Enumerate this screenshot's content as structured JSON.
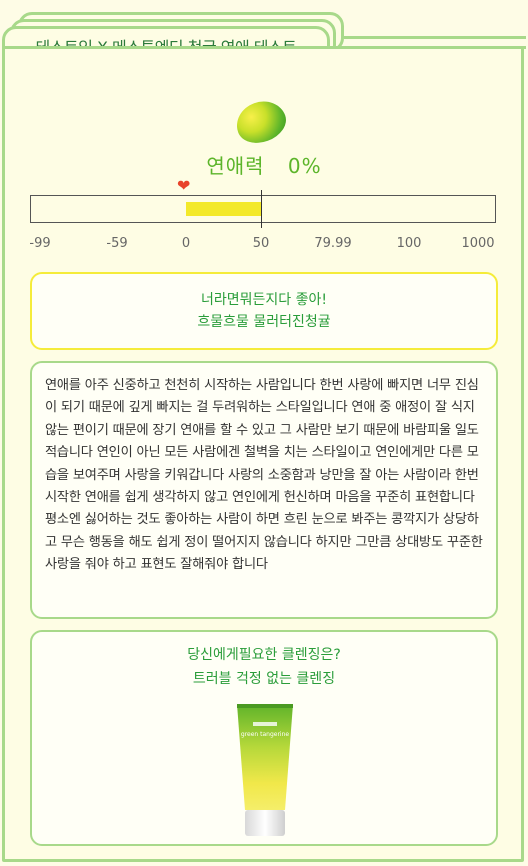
{
  "header": {
    "title": "테스트잇 X 메스투엔디 청귤 연애 테스트"
  },
  "result": {
    "love_label": "연애력",
    "love_value": "0%",
    "love_fraction": 0.0
  },
  "gauge": {
    "ticks": [
      "-99",
      "-59",
      "0",
      "50",
      "79.99",
      "100",
      "1000"
    ]
  },
  "banner": {
    "line1": "너라면뭐든지다 좋아!",
    "line2": "흐물흐물 물러터진청귤"
  },
  "description": {
    "text": "연애를 아주 신중하고 천천히 시작하는 사람입니다 한번 사랑에 빠지면 너무 진심이 되기 때문에 깊게 빠지는 걸 두려워하는 스타일입니다 연애 중 애정이 잘 식지 않는 편이기 때문에 장기 연애를 할 수 있고 그 사람만 보기 때문에 바람피울 일도 적습니다 연인이 아닌 모든 사람에겐 철벽을 치는 스타일이고 연인에게만 다른 모습을 보여주며 사랑을 키워갑니다 사랑의 소중함과 낭만을 잘 아는 사람이라 한번 시작한 연애를 쉽게 생각하지 않고 연인에게 헌신하며 마음을 꾸준히 표현합니다 평소엔 싫어하는 것도 좋아하는 사람이 하면 흐린 눈으로 봐주는 콩깍지가 상당하고 무슨 행동을 해도 쉽게 정이 떨어지지 않습니다 하지만 그만큼 상대방도 꾸준한 사랑을 줘야 하고 표현도 잘해줘야 합니다"
  },
  "recommendation": {
    "question": "당신에게필요한 클렌징은?",
    "answer": "트러블 걱정 없는 클렌징",
    "product_label": "green tangerine"
  },
  "colors": {
    "accent_green": "#2a9d3a",
    "border_green": "#a8d98a",
    "banner_yellow": "#f5ec3a",
    "heart_red": "#e8432a"
  }
}
